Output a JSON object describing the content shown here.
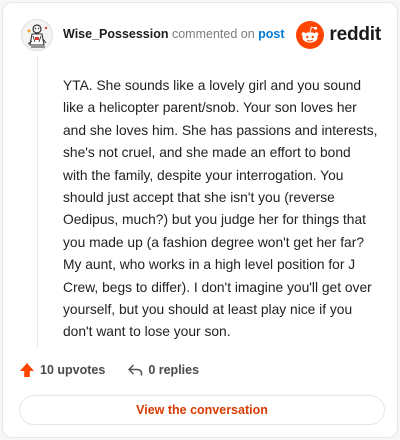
{
  "header": {
    "username": "Wise_Possession",
    "action_text": " commented on ",
    "post_link": "post",
    "brand_name": "reddit",
    "brand_color": "#ff4500"
  },
  "comment": {
    "text": "YTA. She sounds like a lovely girl and you sound like a helicopter parent/snob. Your son loves her and she loves him. She has passions and interests, she's not cruel, and she made an effort to bond with the family, despite your interrogation. You should just accept that she isn't you (reverse Oedipus, much?) but you judge her for things that you made up (a fashion degree won't get her far? My aunt, who works in a high level position for J Crew, begs to differ). I don't imagine you'll get over yourself, but you should at least play nice if you don't want to lose your son."
  },
  "actions": {
    "upvotes_label": "10 upvotes",
    "upvote_icon": "upvote-arrow-icon",
    "upvote_color": "#ff4500",
    "replies_label": "0 replies",
    "reply_icon": "reply-arrow-icon"
  },
  "footer": {
    "view_conversation_label": "View the conversation",
    "accent_color": "#d93a00"
  }
}
